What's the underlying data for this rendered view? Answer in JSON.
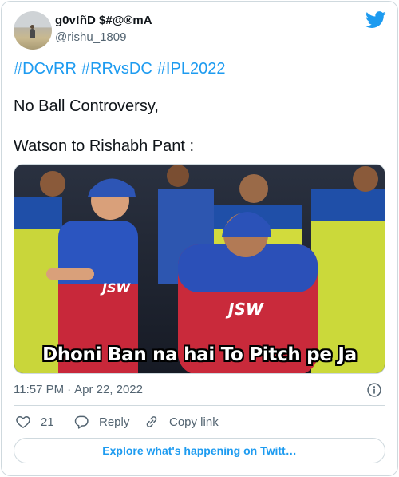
{
  "author": {
    "display_name": "g0v!ñD $#@®mA",
    "handle": "@rishu_1809"
  },
  "tweet": {
    "hashtags": [
      "#DCvRR",
      "#RRvsDC",
      "#IPL2022"
    ],
    "line1": "No Ball Controversy,",
    "line2": "Watson to Rishabh Pant :",
    "media_caption": "Dhoni Ban na hai To Pitch pe Ja",
    "time": "11:57 PM",
    "date": "Apr 22, 2022"
  },
  "actions": {
    "like_count": "21",
    "reply_label": "Reply",
    "copy_label": "Copy link"
  },
  "explore_label": "Explore what's happening on Twitt…",
  "icons": [
    "twitter-bird-icon",
    "info-icon",
    "heart-icon",
    "reply-bubble-icon",
    "link-icon"
  ],
  "colors": {
    "accent": "#1d9bf0",
    "text": "#0f1419",
    "secondary": "#536471",
    "border": "#cfd9de"
  }
}
